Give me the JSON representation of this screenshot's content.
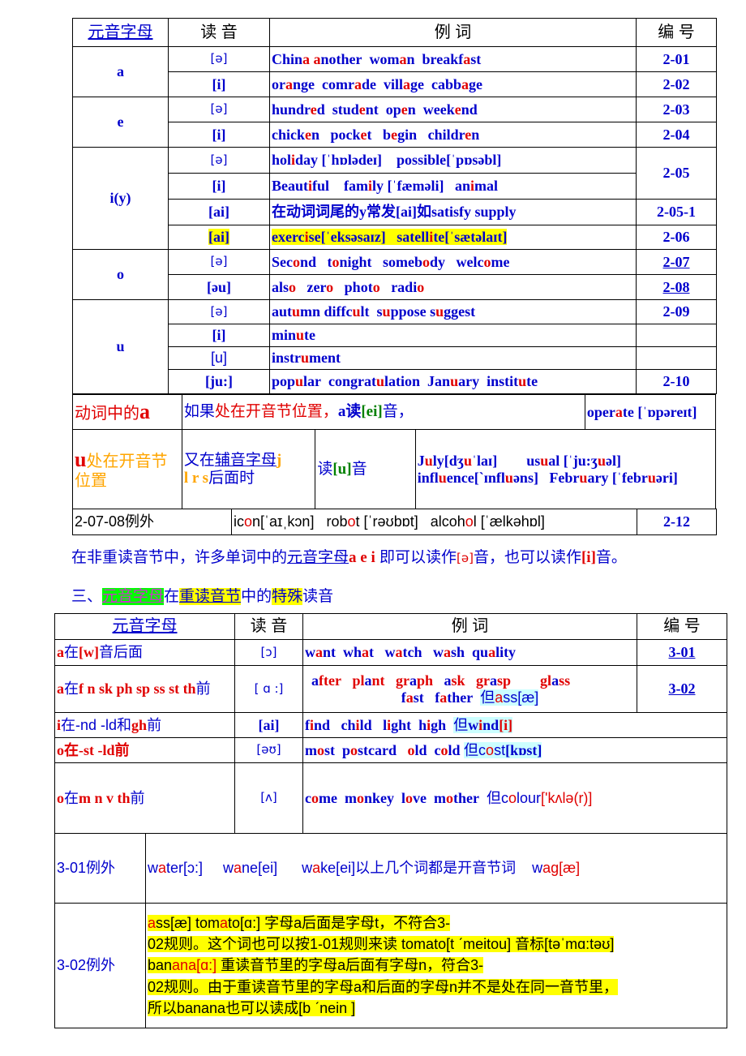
{
  "table1": {
    "headers": {
      "letter": "元音字母",
      "sound": "读 音",
      "examples": "例 词",
      "number": "编 号"
    },
    "groups": {
      "a": {
        "letter": "a",
        "rows": [
          {
            "sound": "[ə]",
            "pre": [
              "Chin",
              "a",
              " ",
              "a",
              "nother  wom",
              "a",
              "n  breakf",
              "a",
              "st"
            ],
            "number": "2-01"
          },
          {
            "sound": "[i]",
            "pre": [
              "or",
              "a",
              "nge  comr",
              "a",
              "de  vill",
              "a",
              "ge  cabb",
              "a",
              "ge"
            ],
            "number": "2-02"
          }
        ]
      },
      "e": {
        "letter": "e",
        "rows": [
          {
            "sound": "[ə]",
            "pre": [
              "hundr",
              "e",
              "d  stud",
              "e",
              "nt  op",
              "e",
              "n  week",
              "e",
              "nd"
            ],
            "number": "2-03"
          },
          {
            "sound": "[i]",
            "pre": [
              "chick",
              "e",
              "n   pock",
              "e",
              "t   b",
              "e",
              "gin   childr",
              "e",
              "n"
            ],
            "number": "2-04"
          }
        ]
      },
      "i": {
        "letter": "i(y)",
        "rows": [
          {
            "sound": "[ə]",
            "pre": [
              "hol",
              "i",
              "day [ˈhɒlədeɪ]    possi",
              "",
              "ble[ˈpɒsəbl]",
              "",
              ""
            ],
            "number": "2-05"
          },
          {
            "sound": "[i]",
            "pre": [
              "Beaut",
              "i",
              "ful    fam",
              "i",
              "ly [ˈfæməli]   an",
              "i",
              "mal"
            ]
          },
          {
            "sound": "[ai]",
            "text": "在动词词尾的y常发[ai]如satisfy   supply",
            "number": "2-05-1"
          },
          {
            "sound": "[ai]",
            "pre": [
              "exerc",
              "i",
              "se[ˈeksəsaɪz]   satell",
              "i",
              "te[ˈsætəlaɪt]"
            ],
            "number": "2-06"
          }
        ]
      },
      "o": {
        "letter": "o",
        "rows": [
          {
            "sound": "[ə]",
            "pre": [
              "Sec",
              "o",
              "nd   t",
              "o",
              "night   someb",
              "o",
              "dy   welc",
              "o",
              "me"
            ],
            "number": "2-07"
          },
          {
            "sound": "[əu]",
            "pre": [
              " als",
              "o",
              "   zer",
              "o",
              "   phot",
              "o",
              "   radi",
              "o",
              ""
            ],
            "number": "2-08"
          }
        ]
      },
      "u": {
        "letter": "u",
        "rows": [
          {
            "sound": "[ə]",
            "pre": [
              "aut",
              "u",
              "mn diffc",
              "u",
              "lt  s",
              "u",
              "ppose s",
              "u",
              "ggest"
            ],
            "number": "2-09"
          },
          {
            "sound": "[i]",
            "pre": [
              " min",
              "u",
              "te"
            ],
            "number": ""
          },
          {
            "sound": "[u]",
            "pre": [
              " instr",
              "u",
              "ment"
            ],
            "number": ""
          },
          {
            "sound": "[ju:]",
            "pre": [
              "pop",
              "u",
              "lar  congrat",
              "u",
              "lation  Jan",
              "u",
              "ary  instit",
              "u",
              "te"
            ],
            "number": "2-10"
          }
        ]
      }
    },
    "verb_a": {
      "label_part1": "动词",
      "label_part2": "中的",
      "label_letter": "a",
      "rule_part1": "如果",
      "rule_part2": "处在开音节位置，",
      "rule_part3": "a读",
      "rule_part4": "[ei]",
      "rule_part5": "音，",
      "example_pre": "oper",
      "example_hl": "a",
      "example_post": "te [ˈɒpəreɪt]"
    },
    "u_open": {
      "label_letter": "u",
      "label_text": "处在开音节位置",
      "cond_part1": "又在",
      "cond_link": "辅音字母",
      "cond_letters1": "j",
      "cond_letters2": "l r s",
      "cond_part2": "后面时",
      "sound_pre": "读",
      "sound": "[u]",
      "sound_post": "音",
      "ex_line1": [
        "J",
        "u",
        "ly[dʒ",
        "u",
        "ˈlaɪ]        us",
        "u",
        "al [ˈju:ʒ",
        "u",
        "əl]"
      ],
      "ex_line2": [
        " infl",
        "u",
        "ence[ˋɪnfl",
        "u",
        "əns]   Febr",
        "u",
        "ary [ˈfebr",
        "u",
        "əri]"
      ]
    },
    "exception_row": {
      "label": "2-07-08例外",
      "words": [
        "ic",
        "o",
        "n[ˈaɪˌkɔn]   rob",
        "o",
        "t [ˈrəʊbɒt]   alcoh",
        "o",
        "l [ˈælkəhɒl]"
      ],
      "number": "2-12"
    }
  },
  "note1": {
    "part1": "在非重读音节中，许多单词中的",
    "link": "元音字母",
    "letters": "a e i",
    "part2": " 即可以读作",
    "sound1": "[ə]",
    "part3": "音，也可以读作",
    "sound2": "[i]",
    "part4": "音。"
  },
  "heading3": {
    "prefix": "三、",
    "hl1": "元音字母",
    "mid1": "在",
    "hl2": "重读音节",
    "mid2": "中的",
    "hl3": "特殊",
    "suffix": "读音"
  },
  "table2": {
    "headers": {
      "letter": "元音字母",
      "sound": "读 音",
      "examples": "例 词",
      "number": "编 号"
    },
    "rows": [
      {
        "rule": [
          "a",
          "在",
          "[w]",
          "音后面"
        ],
        "sound": "[ɔ]",
        "ex": [
          "w",
          "a",
          "nt  wh",
          "a",
          "t   w",
          "a",
          "tch   w",
          "a",
          "sh  qu",
          "a",
          "lity"
        ],
        "number": "3-01"
      },
      {
        "rule": [
          "a",
          "在",
          "f n sk ph sp ss st th",
          "前"
        ],
        "sound": "[ ɑ :]",
        "ex1": [
          "a",
          "fter   pl",
          "a",
          "nt   gr",
          "a",
          "ph   ",
          "a",
          "sk   gr",
          "a",
          "sp        gl",
          "a",
          "ss"
        ],
        "ex2": [
          "f",
          "a",
          "st   f",
          "a",
          "ther  "
        ],
        "ex2_but": "但",
        "ex2_a": "a",
        "ex2_rest": "ss[æ]",
        "number": "3-02"
      },
      {
        "rule": [
          "i",
          "在-nd -ld和",
          "gh",
          "前"
        ],
        "sound": "[ai]",
        "ex": [
          " f",
          "i",
          "nd   ch",
          "i",
          "ld   l",
          "i",
          "ght  h",
          "i",
          "gh  "
        ],
        "but": "但",
        "but_word_pre": "w",
        "but_word_hl": "i",
        "but_word_post": "nd",
        "but_sound": "[i]"
      },
      {
        "rule": [
          "o",
          "在-st -ld前"
        ],
        "sound": "[əʊ]",
        "ex": [
          "m",
          "o",
          "st  p",
          "o",
          "stcard   ",
          "o",
          "ld  c",
          "o",
          "ld "
        ],
        "but": "但",
        "but_word_pre": "c",
        "but_word_hl": "o",
        "but_word_post": "st",
        "but_sound": "[kɒst]"
      },
      {
        "rule": [
          "o",
          "在",
          "m n v th",
          "前"
        ],
        "sound": "[ʌ]",
        "ex": [
          " c",
          "o",
          "me  m",
          "o",
          "nkey  l",
          "o",
          "ve  m",
          "o",
          "ther  "
        ],
        "but": "但",
        "but_word_pre": "c",
        "but_word_hl": "o",
        "but_word_post": "lour",
        "but_sound": "['kʌlə(r)]"
      }
    ],
    "exc1": {
      "label": "3-01例外",
      "parts": [
        "w",
        "a",
        "ter[ɔ:]     w",
        "a",
        "ne[ei]      w",
        "a",
        "ke[ei]以上几个词都是开音节词    w",
        "ag[æ]"
      ]
    },
    "exc2": {
      "label": "3-02例外",
      "line1_a": "a",
      "line1": "ss[æ]     tom",
      "line1_a2": "a",
      "line1_rest": "to[ɑ:] 字母a后面是字母t，不符合3-",
      "line2": "02规则。这个词也可以按1-01规则来读 tomato[t ˊmeitou] 音标[təˈmɑ:təʊ]",
      "line3_pre": "ban",
      "line3_hl": "ana[ɑ:]",
      "line3_rest": " 重读音节里的字母a后面有字母n，符合3-",
      "line4": "02规则。由于重读音节里的字母a和后面的字母n并不是处在同一音节里，",
      "line5": "所以banana也可以读成[b ˊnein ]"
    }
  }
}
